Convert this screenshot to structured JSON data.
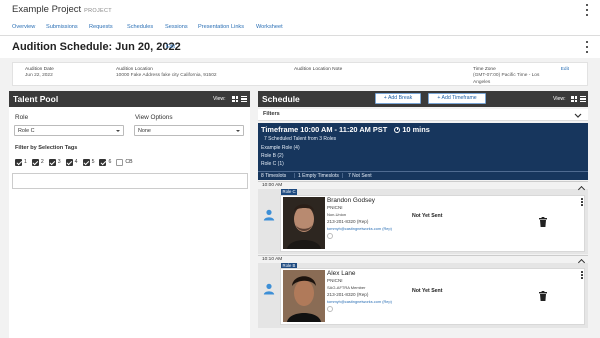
{
  "project": {
    "title": "Example Project",
    "subtitle": "PROJECT"
  },
  "nav": [
    "Overview",
    "Submissions",
    "Requests",
    "Schedules",
    "Sessions",
    "Presentation Links",
    "Worksheet"
  ],
  "header": {
    "title": "Audition Schedule: Jun 20, 2022",
    "edit": "Edit"
  },
  "info": {
    "date_label": "Audition Date",
    "date_value": "Jun 22, 2022",
    "location_label": "Audition Location",
    "location_value": "10000 Fake Address fake city California, 91502",
    "note_label": "Audition Location Note",
    "tz_label": "Time Zone",
    "tz_value_1": "(GMT-07:00) Pacific Time - Los",
    "tz_value_2": "Angeles",
    "edit": "Edit"
  },
  "talent_pool": {
    "title": "Talent Pool",
    "view_label": "View:",
    "role_label": "Role",
    "role_value": "Role C",
    "view_options_label": "View Options",
    "view_options_value": "None",
    "filter_label": "Filter by Selection Tags",
    "tags": [
      {
        "label": "1",
        "checked": true
      },
      {
        "label": "2",
        "checked": true
      },
      {
        "label": "3",
        "checked": true
      },
      {
        "label": "4",
        "checked": true
      },
      {
        "label": "5",
        "checked": true
      },
      {
        "label": "6",
        "checked": true
      },
      {
        "label": "CB",
        "checked": false
      }
    ]
  },
  "schedule": {
    "title": "Schedule",
    "add_break": "+ Add Break",
    "add_timeframe": "+ Add Timeframe",
    "view_label": "View:",
    "filters_label": "Filters",
    "timeframe": {
      "title": "Timeframe 10:00 AM - 11:20 AM PST",
      "duration": "10 mins",
      "scheduled": "7 Scheduled Talent from 3 Roles",
      "roles": [
        "Example Role (4)",
        "Role B (2)",
        "Role C (1)"
      ],
      "stats": [
        "8 Timeslots",
        "1 Empty Timeslots",
        "7 Not Sent"
      ]
    },
    "slots": [
      {
        "time": "10:00 AM",
        "role": "Role C",
        "name": "Brandon Godsey",
        "agency": "PNICNI",
        "union": "Non-Union",
        "phone": "213-201-8320 (Rep)",
        "email": "tommyh@castingnetworks.com (Rep)",
        "status": "Not Yet Sent"
      },
      {
        "time": "10:10 AM",
        "role": "Role B",
        "name": "Alex Lane",
        "agency": "PNICNI",
        "union": "SAG-AFTRA Member",
        "phone": "213-201-8320 (Rep)",
        "email": "tommyh@castingnetworks.com (Rep)",
        "status": "Not Yet Sent"
      }
    ]
  },
  "colors": {
    "accent": "#2a6fb5",
    "timeframe_bg": "#17365d",
    "panel_head": "#3a3a3a",
    "person_icon": "#3d8fd6"
  }
}
